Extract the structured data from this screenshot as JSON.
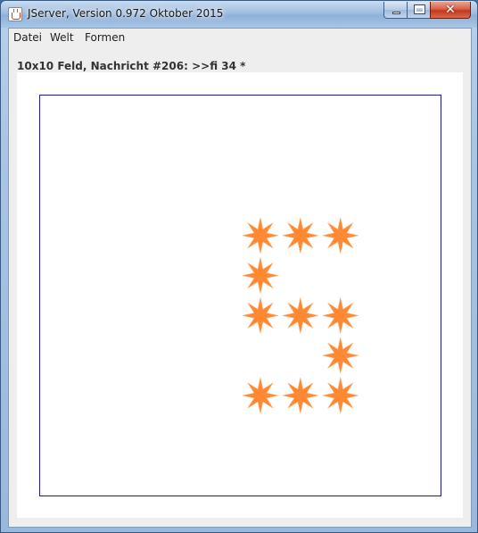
{
  "window": {
    "title": "JServer, Version 0.972 Oktober 2015",
    "close_glyph": "✕"
  },
  "menu": {
    "items": [
      "Datei",
      "Welt",
      "Formen"
    ]
  },
  "status": {
    "text": "10x10 Feld, Nachricht #206: >>fi 34 *"
  },
  "board": {
    "columns": 10,
    "rows": 10,
    "shape": "star-8",
    "shape_color": "#ff8833",
    "border_color": "#1a1a9a",
    "filled_cells": [
      {
        "col": 5,
        "row": 3
      },
      {
        "col": 6,
        "row": 3
      },
      {
        "col": 7,
        "row": 3
      },
      {
        "col": 5,
        "row": 4
      },
      {
        "col": 5,
        "row": 5
      },
      {
        "col": 6,
        "row": 5
      },
      {
        "col": 7,
        "row": 5
      },
      {
        "col": 7,
        "row": 6
      },
      {
        "col": 5,
        "row": 7
      },
      {
        "col": 6,
        "row": 7
      },
      {
        "col": 7,
        "row": 7
      }
    ]
  }
}
